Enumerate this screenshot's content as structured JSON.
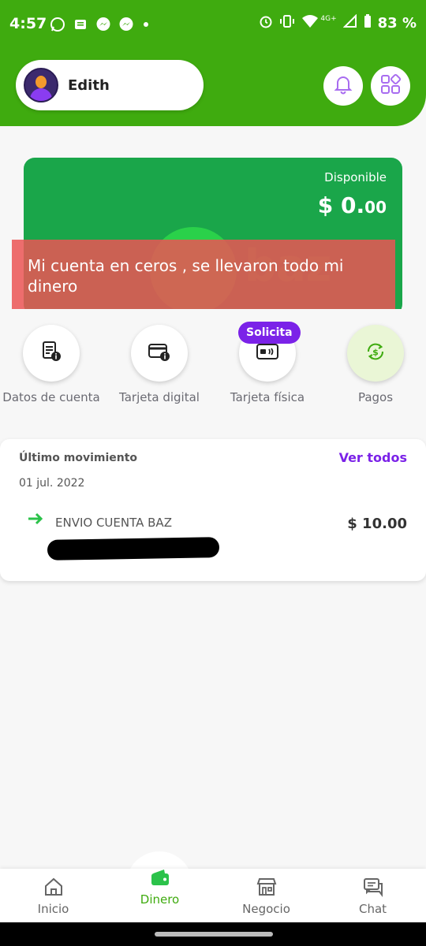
{
  "status_bar": {
    "time": "4:57",
    "battery": "83 %",
    "network": "4G+",
    "left_icons": [
      "whatsapp-icon",
      "news-icon",
      "messenger-icon",
      "messenger-icon"
    ],
    "right_icons": [
      "alarm-icon",
      "vibrate-icon",
      "wifi-icon",
      "signal-icon",
      "battery-icon"
    ]
  },
  "header": {
    "user_name": "Edith",
    "accent_color": "#3fab0f"
  },
  "balance_card": {
    "label": "Disponible",
    "amount_main": "$ 0.",
    "amount_cents": "00",
    "color": "#1aa64a"
  },
  "overlay": {
    "text": "Mi cuenta en ceros , se llevaron todo mi dinero"
  },
  "actions": [
    {
      "label": "Datos de cuenta",
      "icon": "account-data-icon"
    },
    {
      "label": "Tarjeta digital",
      "icon": "digital-card-icon"
    },
    {
      "label": "Tarjeta física",
      "icon": "physical-card-icon",
      "badge": "Solicita"
    },
    {
      "label": "Pagos",
      "icon": "payments-icon"
    }
  ],
  "movement": {
    "title": "Último movimiento",
    "link": "Ver todos",
    "date": "01 jul. 2022",
    "description": "ENVIO CUENTA BAZ",
    "amount": "$ 10.00"
  },
  "bottom_nav": {
    "items": [
      {
        "label": "Inicio",
        "icon": "home-icon"
      },
      {
        "label": "Dinero",
        "icon": "wallet-icon",
        "active": true
      },
      {
        "label": "Negocio",
        "icon": "store-icon"
      },
      {
        "label": "Chat",
        "icon": "chat-icon"
      }
    ]
  }
}
